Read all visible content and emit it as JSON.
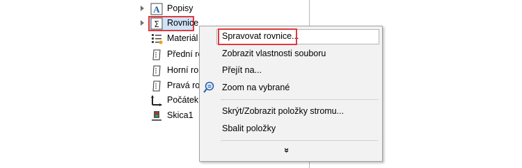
{
  "tree": {
    "items": [
      {
        "label": "Popisy",
        "icon": "annotations-icon"
      },
      {
        "label": "Rovnice",
        "icon": "equations-icon"
      },
      {
        "label": "Materiál",
        "icon": "material-icon"
      },
      {
        "label": "Přední ro",
        "icon": "plane-icon"
      },
      {
        "label": "Horní ro",
        "icon": "plane-icon"
      },
      {
        "label": "Pravá ro",
        "icon": "plane-icon"
      },
      {
        "label": "Počátek",
        "icon": "origin-icon"
      },
      {
        "label": "Skica1",
        "icon": "sketch-icon"
      }
    ]
  },
  "context_menu": {
    "items": [
      {
        "label": "Spravovat rovnice..."
      },
      {
        "label": "Zobrazit vlastnosti souboru"
      },
      {
        "label": "Přejít na..."
      },
      {
        "label": "Zoom na vybrané",
        "icon": "zoom-selection-icon"
      },
      {
        "label": "Skrýt/Zobrazit položky stromu..."
      },
      {
        "label": "Sbalit položky"
      }
    ],
    "more_glyph": "»"
  },
  "colors": {
    "highlight_border": "#e0393f",
    "selection": "#cfe3f7"
  }
}
